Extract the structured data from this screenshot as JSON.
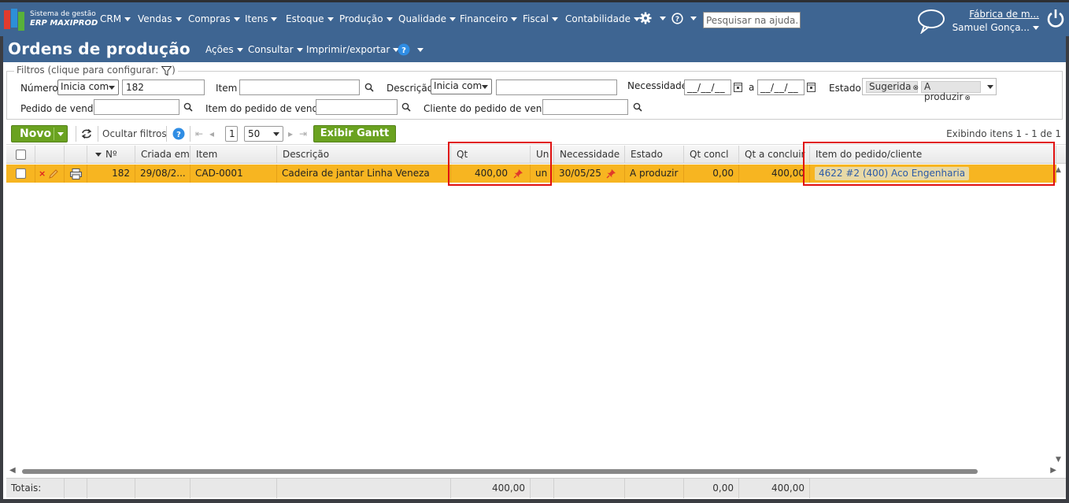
{
  "brand": {
    "line1": "Sistema de gestão",
    "line2": "ERP MAXIPROD"
  },
  "nav": {
    "items": [
      {
        "label": "CRM"
      },
      {
        "label": "Vendas"
      },
      {
        "label": "Compras"
      },
      {
        "label": "Itens"
      },
      {
        "label": "Estoque"
      },
      {
        "label": "Produção"
      },
      {
        "label": "Qualidade"
      },
      {
        "label": "Financeiro"
      },
      {
        "label": "Fiscal"
      },
      {
        "label": "Contabilidade"
      }
    ],
    "search_placeholder": "Pesquisar na ajuda...",
    "company": "Fábrica de m...",
    "user": "Samuel Gonça..."
  },
  "page": {
    "title": "Ordens de produção",
    "menu": {
      "acoes": "Ações",
      "consultar": "Consultar",
      "imprimir": "Imprimir/exportar"
    }
  },
  "filters": {
    "legend": "Filtros (clique para configurar:",
    "legend_end": ")",
    "numero_label": "Número",
    "numero_mode": "Inicia com",
    "numero_value": "182",
    "item_label": "Item",
    "item_value": "",
    "descricao_label": "Descrição",
    "descricao_mode": "Inicia com",
    "descricao_value": "",
    "necessidade_label": "Necessidade",
    "date_from": "__/__/__",
    "date_sep": "a",
    "date_to": "__/__/__",
    "estado_label": "Estado",
    "estado_tags": [
      "Sugerida",
      "A produzir"
    ],
    "pedido_label": "Pedido de venda",
    "item_pedido_label": "Item do pedido de venda",
    "cliente_label": "Cliente do pedido de venda"
  },
  "toolbar": {
    "novo": "Novo",
    "ocultar": "Ocultar filtros",
    "page": "1",
    "per_page": "50",
    "gantt": "Exibir Gantt",
    "exibindo": "Exibindo itens 1 - 1 de 1"
  },
  "table": {
    "headers": {
      "numero": "Nº",
      "criada": "Criada em",
      "item": "Item",
      "descricao": "Descrição",
      "qt": "Qt",
      "un": "Un",
      "necessidade": "Necessidade",
      "estado": "Estado",
      "qt_concl": "Qt concl",
      "qt_concluir": "Qt a concluir",
      "pedido_cliente": "Item do pedido/cliente"
    },
    "rows": [
      {
        "numero": "182",
        "criada": "29/08/2...",
        "item": "CAD-0001",
        "descricao": "Cadeira de jantar Linha Veneza",
        "qt": "400,00",
        "un": "un",
        "necessidade": "30/05/25",
        "estado": "A produzir",
        "qt_concl": "0,00",
        "qt_concluir": "400,00",
        "pedido_cliente": "4622 #2 (400) Aco Engenharia"
      }
    ],
    "totals": {
      "label": "Totais:",
      "qt": "400,00",
      "qt_concl": "0,00",
      "qt_concluir": "400,00"
    }
  },
  "colors": {
    "topbar": "#3e6592",
    "row_highlight": "#f7b521",
    "accent_green": "#6aa220",
    "annotation_red": "#e01010"
  }
}
